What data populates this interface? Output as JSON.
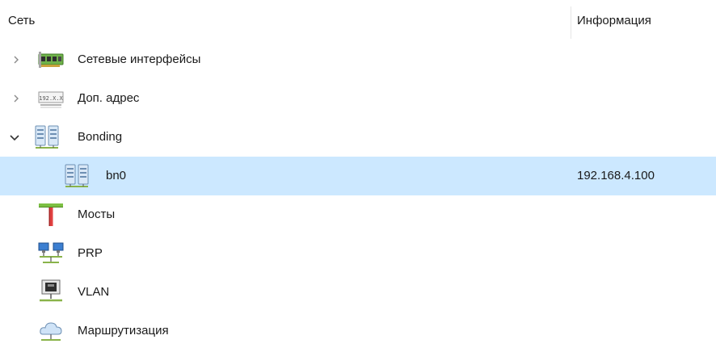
{
  "header": {
    "name_col": "Сеть",
    "info_col": "Информация"
  },
  "tree": {
    "items": [
      {
        "label": "Сетевые интерфейсы",
        "icon": "network-card-icon",
        "expander": "collapsed",
        "info": ""
      },
      {
        "label": "Доп. адрес",
        "icon": "ip-address-icon",
        "expander": "collapsed",
        "info": ""
      },
      {
        "label": "Bonding",
        "icon": "bonding-icon",
        "expander": "expanded",
        "info": ""
      },
      {
        "label": "bn0",
        "icon": "bonding-icon",
        "expander": "none",
        "info": "192.168.4.100",
        "selected": true
      },
      {
        "label": "Мосты",
        "icon": "bridge-icon",
        "expander": "none",
        "info": ""
      },
      {
        "label": "PRP",
        "icon": "prp-icon",
        "expander": "none",
        "info": ""
      },
      {
        "label": "VLAN",
        "icon": "vlan-icon",
        "expander": "none",
        "info": ""
      },
      {
        "label": "Маршрутизация",
        "icon": "routing-icon",
        "expander": "none",
        "info": ""
      }
    ]
  },
  "colors": {
    "selection": "#cce8ff",
    "header_separator": "#e5e5e5"
  }
}
